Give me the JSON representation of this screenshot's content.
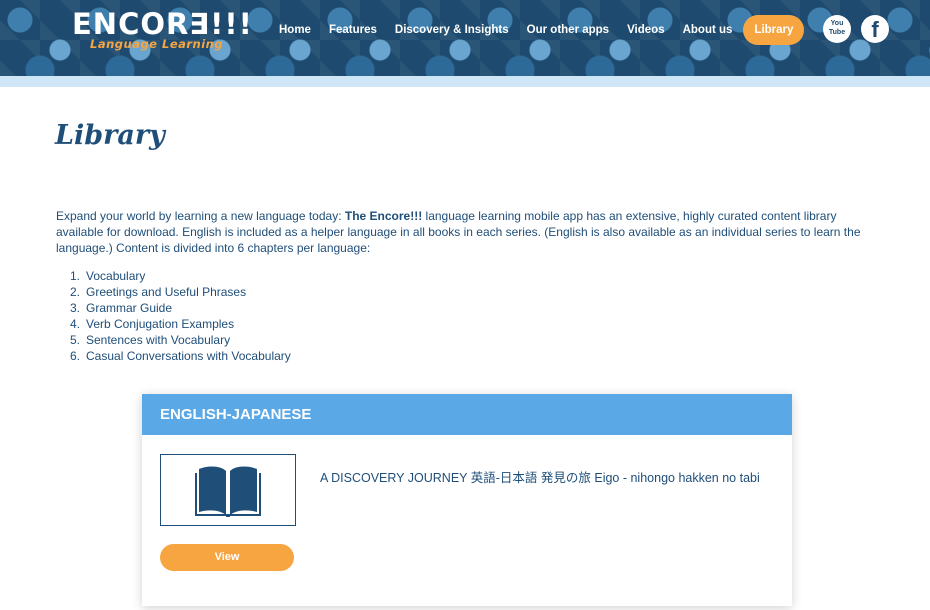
{
  "brand": {
    "logo_text": "ENCOR∃!!!",
    "logo_sub": "Language Learning"
  },
  "nav": {
    "items": [
      {
        "label": "Home"
      },
      {
        "label": "Features"
      },
      {
        "label": "Discovery & Insights"
      },
      {
        "label": "Our other apps"
      },
      {
        "label": "Videos"
      },
      {
        "label": "About us"
      },
      {
        "label": "Library",
        "active": true
      }
    ]
  },
  "social": {
    "youtube_label": "You\nTube",
    "facebook_label": "f"
  },
  "page": {
    "title": "Library",
    "intro_prefix": "Expand your world by learning a new language today: ",
    "intro_brand": "The Encore!!!",
    "intro_suffix": " language learning mobile app has an extensive, highly curated content library available for download. English is included as a helper language in all books in each series. (English is also available as an individual series to learn the language.) Content is divided into 6 chapters per language:",
    "chapters": [
      {
        "num": "1.",
        "label": "Vocabulary"
      },
      {
        "num": "2.",
        "label": "Greetings and Useful Phrases"
      },
      {
        "num": "3.",
        "label": "Grammar Guide"
      },
      {
        "num": "4.",
        "label": "Verb Conjugation Examples"
      },
      {
        "num": "5.",
        "label": "Sentences with Vocabulary"
      },
      {
        "num": "6.",
        "label": "Casual Conversations with Vocabulary"
      }
    ]
  },
  "card": {
    "heading": "ENGLISH-JAPANESE",
    "book_title": "A DISCOVERY JOURNEY 英語-日本語 発見の旅 Eigo - nihongo hakken no tabi",
    "view_label": "View"
  },
  "colors": {
    "header_bg": "#1d4a6e",
    "accent_orange": "#f7a541",
    "card_header_blue": "#5aa8e6",
    "text_navy": "#1f4e79"
  }
}
